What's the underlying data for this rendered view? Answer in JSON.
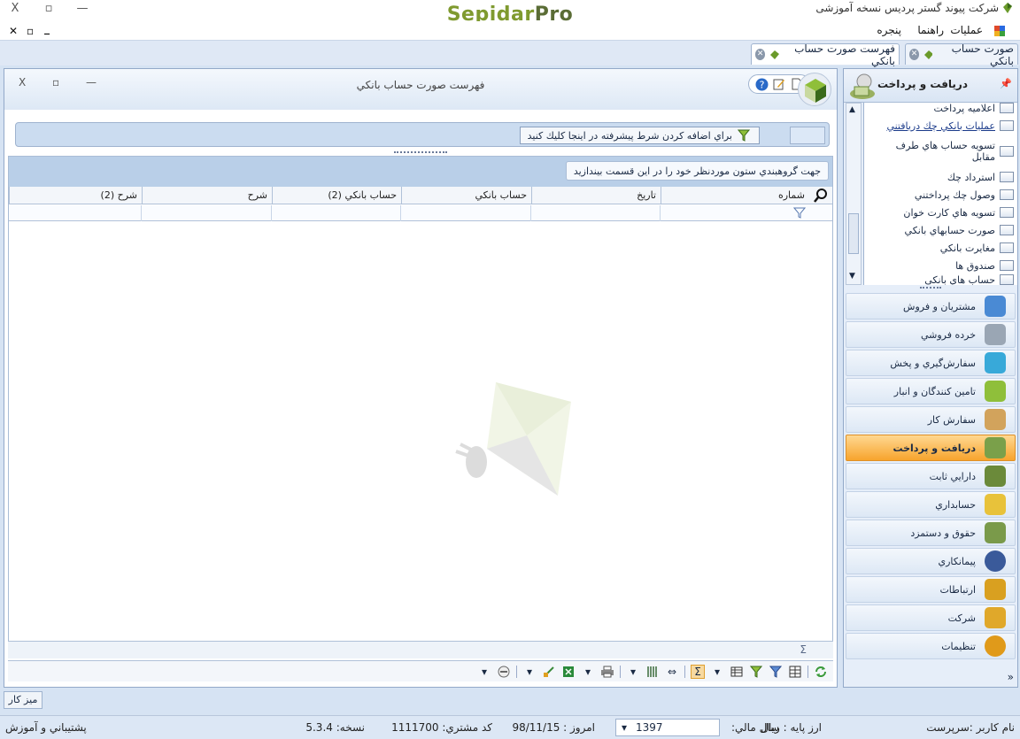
{
  "app": {
    "logo_left": "Sepidar",
    "logo_right": "Pro",
    "title": "شرکت پیوند گستر پردیس نسخه آموزشی",
    "window_controls": {
      "close": "X",
      "restore": "▫",
      "minimize": "—"
    }
  },
  "menubar": {
    "items": [
      "عملیات",
      "راهنما",
      "پنجره"
    ],
    "mdi_controls": {
      "close": "✕",
      "restore": "▫",
      "minimize": "_"
    }
  },
  "tabs": [
    {
      "label": "صورت حساب بانكي",
      "active": false
    },
    {
      "label": "فهرست صورت حساب بانكي",
      "active": true
    }
  ],
  "main_window": {
    "title": "فهرست صورت حساب بانكي",
    "controls": {
      "close": "X",
      "restore": "▫",
      "minimize": "—"
    },
    "filter_button": "براي اضافه كردن شرط پيشرفته در اينجا كليك كنيد",
    "group_hint": "جهت گروهبندي ستون موردنظر خود را در اين قسمت بيندازيد",
    "columns": [
      "شماره",
      "تاريخ",
      "حساب بانكي",
      "حساب بانكي (2)",
      "شرح",
      "شرح (2)"
    ],
    "footer_symbol": "Σ"
  },
  "right_panel": {
    "title": "دریافت و پرداخت",
    "pin": "ᵖ",
    "sub_items": [
      {
        "label": "اعلاميه پرداخت"
      },
      {
        "label": "عمليات بانكي چك دريافتني",
        "link": true
      },
      {
        "label": "تسويه حساب هاي طرف مقابل"
      },
      {
        "label": "استرداد چك"
      },
      {
        "label": "وصول چك پرداختني"
      },
      {
        "label": "تسويه هاي كارت خوان"
      },
      {
        "label": "صورت حسابهاي بانكي"
      },
      {
        "label": "مغايرت بانكي"
      },
      {
        "label": "صندوق ها"
      },
      {
        "label": "حساب هاي بانكي"
      }
    ],
    "modules": [
      {
        "label": "مشتريان و فروش",
        "color": "#4a8ad4"
      },
      {
        "label": "خرده فروشي",
        "color": "#9aa6b4"
      },
      {
        "label": "سفارش‌گيري و پخش",
        "color": "#38a9d9"
      },
      {
        "label": "تامين كنندگان و انبار",
        "color": "#8fbf3a"
      },
      {
        "label": "سفارش كار",
        "color": "#d2a35c"
      },
      {
        "label": "دريافت و پرداخت",
        "color": "#7aa04a",
        "active": true
      },
      {
        "label": "دارايي ثابت",
        "color": "#6b8a3a"
      },
      {
        "label": "حسابداري",
        "color": "#e8c23a"
      },
      {
        "label": "حقوق و دستمزد",
        "color": "#7a9a4a"
      },
      {
        "label": "پيمانكاري",
        "color": "#3a5a9a"
      },
      {
        "label": "ارتباطات",
        "color": "#d9a020"
      },
      {
        "label": "شركت",
        "color": "#e0a82a"
      },
      {
        "label": "تنظيمات",
        "color": "#e09a1a"
      }
    ],
    "expand": "»"
  },
  "desktop_button": "ميز كار",
  "status": {
    "user": "نام كاربر :سرپرست",
    "currency": "ارز پايه :   ريال",
    "fiscal_year_label": "سال مالي:",
    "fiscal_year": "1397",
    "today": "امروز :   98/11/15",
    "customer_code": "كد مشتري:   1111700",
    "version": "نسخه:   5.3.4",
    "support": "پشتيباني و آموزش"
  },
  "colors": {
    "accent": "#f7a42d",
    "brand_green": "#7f9a2f",
    "panel": "#d6e3f3"
  }
}
